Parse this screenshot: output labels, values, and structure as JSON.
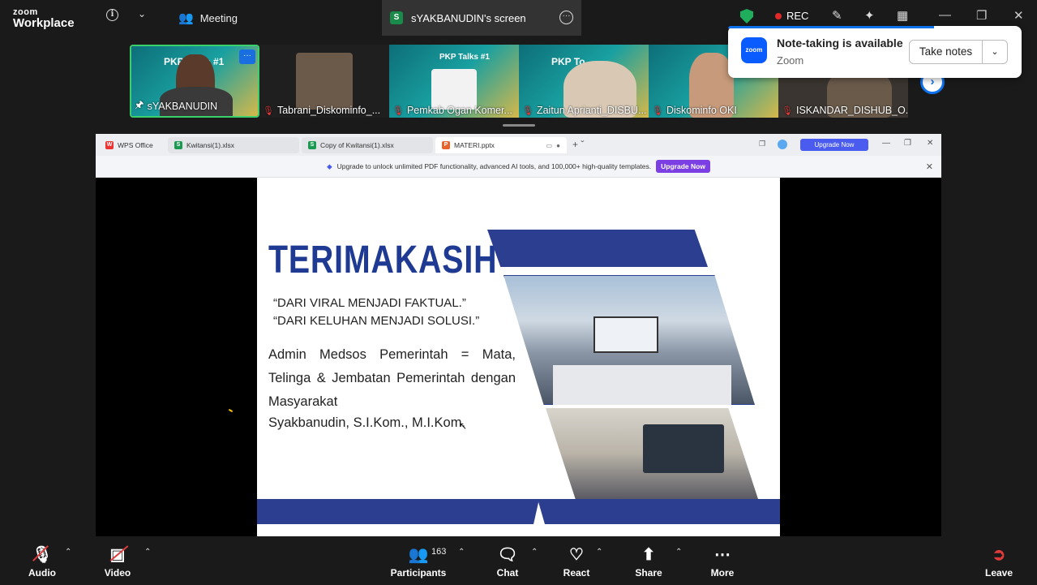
{
  "app": {
    "brand_small": "zoom",
    "brand_big": "Workplace"
  },
  "topbar": {
    "meeting_label": "Meeting",
    "screen_tab_label": "sYAKBANUDIN's screen",
    "screen_badge": "S",
    "rec_label": "REC"
  },
  "participants": [
    {
      "name": "sYAKBANUDIN",
      "active": true,
      "muted": false
    },
    {
      "name": "Tabrani_Diskominfo_...",
      "muted": true
    },
    {
      "name": "Pemkab Ogan Komer...",
      "muted": true
    },
    {
      "name": "Zaitun Aprianti_DISBU...",
      "muted": true
    },
    {
      "name": "Diskominfo OKI",
      "muted": true
    },
    {
      "name": "ISKANDAR_DISHUB_O...",
      "muted": true
    }
  ],
  "tile_text": {
    "pkp": "PKP Talks #1",
    "pkp_short": "PKP To"
  },
  "note_popup": {
    "title": "Note-taking is available",
    "subtitle": "Zoom",
    "button": "Take notes",
    "logo": "zoom"
  },
  "wps": {
    "tabs": [
      "WPS Office",
      "Kwitansi(1).xlsx",
      "Copy of Kwitansi(1).xlsx",
      "MATERI.pptx"
    ],
    "upgrade_button": "Upgrade Now",
    "banner_text": "Upgrade to unlock unlimited PDF functionality, advanced AI tools, and 100,000+ high-quality templates.",
    "banner_button": "Upgrade Now"
  },
  "slide": {
    "title": "TERIMAKASIH",
    "quote1": "“DARI VIRAL MENJADI FAKTUAL.”",
    "quote2": "“DARI KELUHAN MENJADI SOLUSI.”",
    "paragraph": "Admin Medsos Pemerintah = Mata, Telinga & Jembatan Pemerintah dengan Masyarakat",
    "author": "Syakbanudin, S.I.Kom., M.I.Kom.",
    "accent_color": "#2c3e8f"
  },
  "toolbar": {
    "audio": "Audio",
    "video": "Video",
    "participants": "Participants",
    "participant_count": "163",
    "chat": "Chat",
    "react": "React",
    "share": "Share",
    "more": "More",
    "leave": "Leave"
  }
}
